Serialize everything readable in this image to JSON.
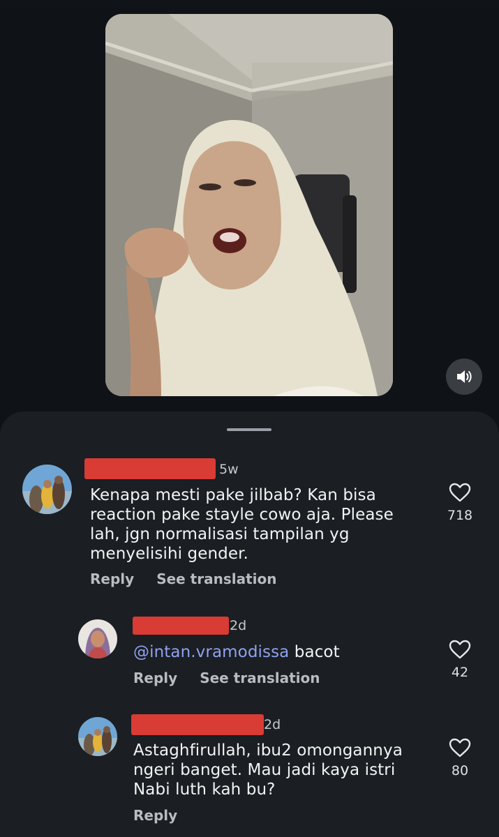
{
  "video": {
    "sound_icon": "speaker-icon"
  },
  "comments": [
    {
      "time": "5w",
      "text": "Kenapa mesti pake jilbab? Kan bisa reaction pake stayle cowo aja. Please lah, jgn normalisasi tampilan yg menyelisihi gender.",
      "lines": [
        "Kenapa mesti pake jilbab? Kan bisa",
        "reaction pake stayle cowo aja. Please",
        "lah, jgn normalisasi tampilan yg",
        "menyelisihi gender."
      ],
      "reply_label": "Reply",
      "translate_label": "See translation",
      "likes": "718"
    },
    {
      "time": "2d",
      "mention": "intan.vramodissa",
      "text": "bacot",
      "reply_label": "Reply",
      "translate_label": "See translation",
      "likes": "42"
    },
    {
      "time": "2d",
      "lines": [
        "Astaghfirullah, ibu2 omongannya",
        "ngeri banget. Mau jadi kaya istri",
        "Nabi luth kah bu?"
      ],
      "reply_label": "Reply",
      "likes": "80"
    }
  ],
  "colors": {
    "background": "#0f1216",
    "sheet": "#1b1e22",
    "redaction": "#d93b35",
    "mention": "#8ea2f0"
  }
}
